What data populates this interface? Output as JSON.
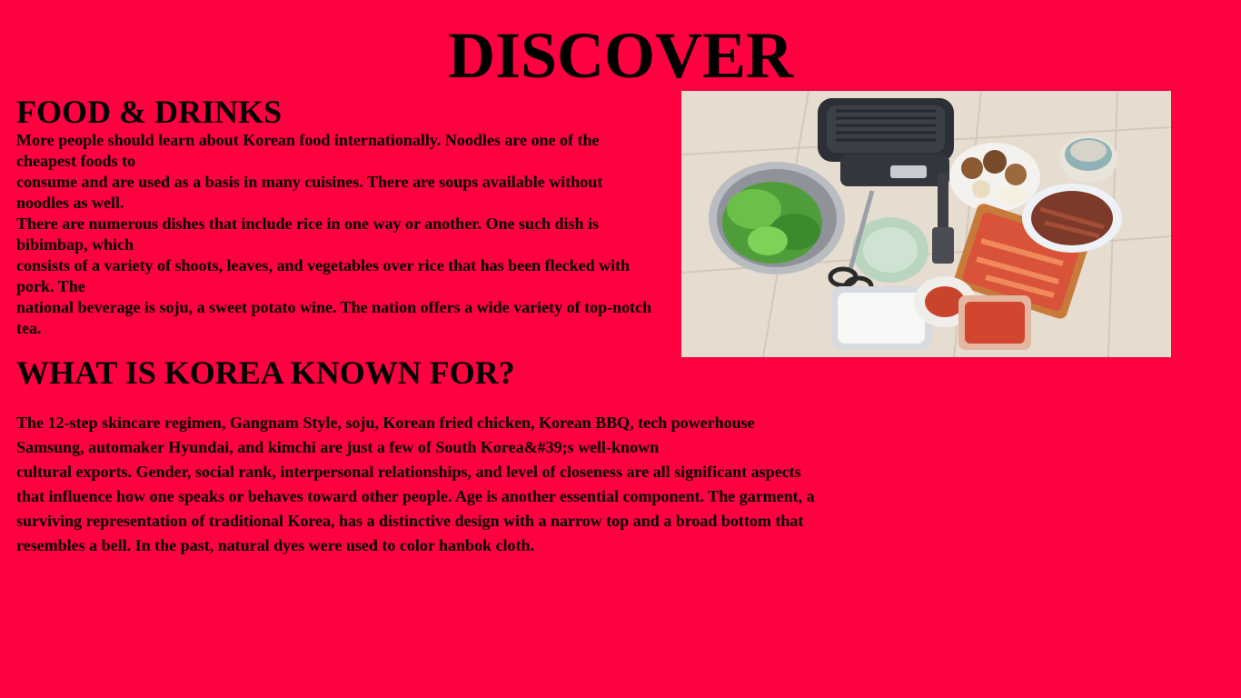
{
  "page": {
    "title": "DISCOVER",
    "background_color": "#ff0040"
  },
  "food_section": {
    "heading": "FOOD & DRINKS",
    "lines": [
      "More people should learn about Korean food internationally. Noodles are one of the cheapest foods to",
      "consume and are used as a basis in many cuisines. There are soups available without noodles as well.",
      "There are numerous dishes that include rice in one way or another. One such dish is bibimbap, which",
      "consists of a variety of shoots, leaves, and vegetables over rice that has been flecked with pork. The",
      "national beverage is soju, a sweet potato wine. The nation offers a wide variety of top-notch tea."
    ],
    "image": {
      "icon": "korean-bbq-photo"
    }
  },
  "korea_section": {
    "heading": "WHAT IS KOREA KNOWN FOR?",
    "lines": [
      "The 12-step skincare regimen, Gangnam Style, soju, Korean fried chicken, Korean BBQ, tech powerhouse Samsung, automaker Hyundai, and kimchi are just a few of South Korea&#39;s well-known",
      "cultural exports. Gender, social rank, interpersonal relationships, and level of closeness are all significant aspects that influence how one speaks or behaves toward other people. Age is another essential component. The garment, a surviving representation of traditional Korea, has a distinctive design with a narrow top and a broad bottom that resembles a bell. In the past, natural dyes were used to color hanbok cloth."
    ]
  }
}
